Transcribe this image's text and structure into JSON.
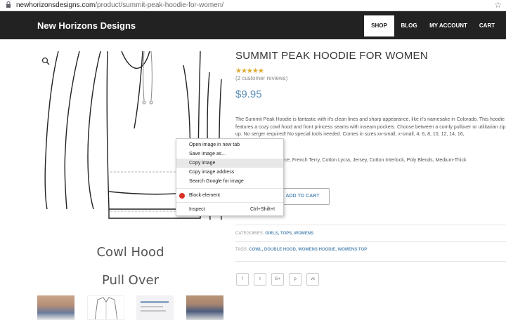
{
  "browser": {
    "url_host": "newhorizonsdesigns.com",
    "url_path": "/product/summit-peak-hoodie-for-women/"
  },
  "nav": {
    "brand": "New Horizons Designs",
    "items": [
      "SHOP",
      "BLOG",
      "MY ACCOUNT",
      "CART"
    ],
    "active": "SHOP"
  },
  "gallery": {
    "caption_1": "Cowl Hood",
    "caption_2": "Pull Over"
  },
  "product": {
    "title": "SUMMIT PEAK HOODIE FOR WOMEN",
    "rating": 5,
    "stars": "★★★★★",
    "reviews": "(2 customer reviews)",
    "price": "$9.95",
    "description": "The Summit Peak Hoodie is fantastic with it's clean lines and sharp appearance, like it's namesake in Colorado. This hoodie features a cozy cowl hood and front princess seams with inseam pockets. Choose between a comfy pullover or utilitarian zip up. No serger required! No special tools needed. Comes in sizes xx-small, x-small, 4, 6, 8, 10, 12, 14, 16,",
    "fabrics": "atshirt Fleece, French Terry, Cotton Lycra, Jersey, Cotton Interlock, Poly Blends, Medium-Thick",
    "add_to_cart": "ADD TO CART",
    "categories_label": "CATEGORIES:",
    "categories": "GIRLS, TOPS, WOMENS",
    "tags_label": "TAGS:",
    "tags": "COWL, DOUBLE HOOD, WOMENS HOODIE, WOMENS TOP",
    "share": [
      "f",
      "t",
      "G+",
      "p",
      "vk"
    ]
  },
  "context_menu": {
    "items": [
      "Open image in new tab",
      "Save image as...",
      "Copy image",
      "Copy image address",
      "Search Google for image",
      "Block element",
      "Inspect"
    ],
    "highlighted": "Copy image",
    "inspect_shortcut": "Ctrl+Shift+I"
  },
  "colors": {
    "nav_bg": "#222222",
    "accent": "#5b8eb7",
    "stars": "#e0a82e"
  }
}
